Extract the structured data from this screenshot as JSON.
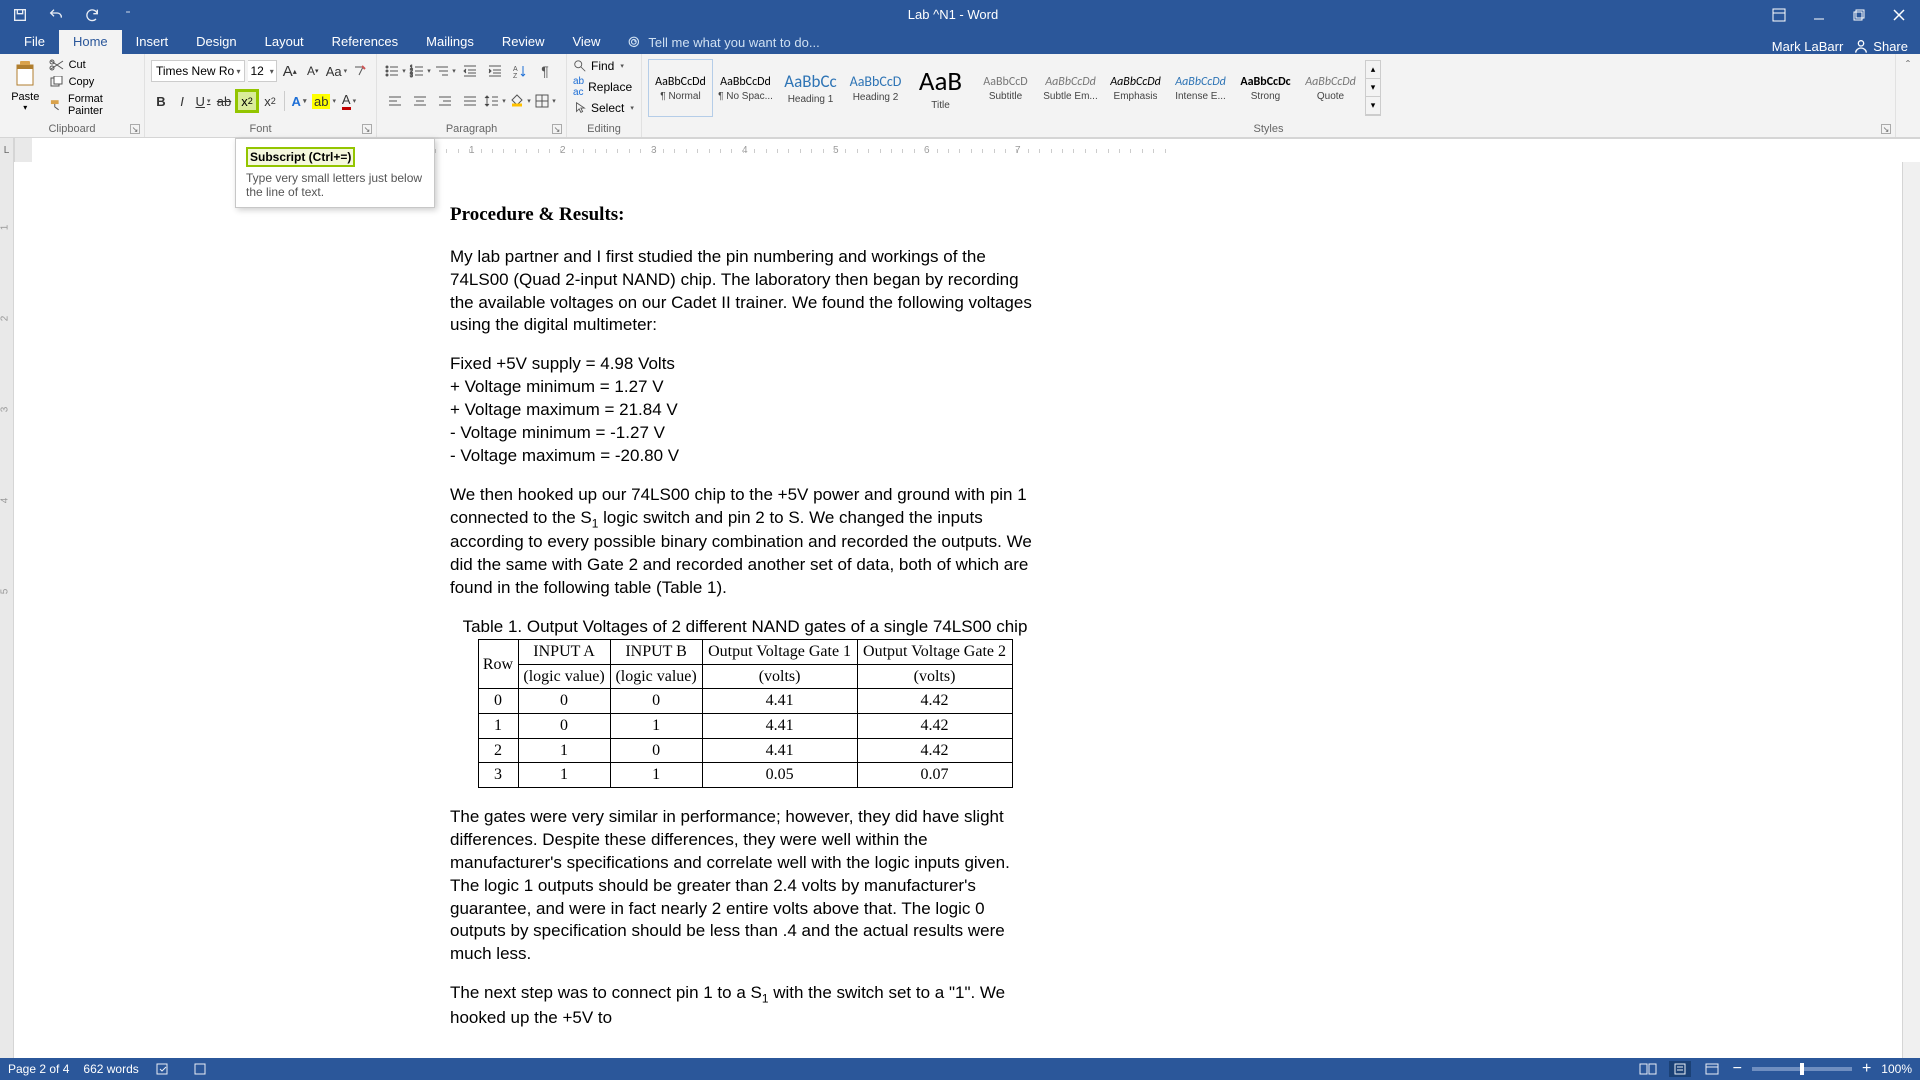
{
  "title": "Lab ^N1 - Word",
  "user": "Mark LaBarr",
  "share": "Share",
  "tabs": [
    "File",
    "Home",
    "Insert",
    "Design",
    "Layout",
    "References",
    "Mailings",
    "Review",
    "View"
  ],
  "tellme_placeholder": "Tell me what you want to do...",
  "clipboard": {
    "paste": "Paste",
    "cut": "Cut",
    "copy": "Copy",
    "painter": "Format Painter",
    "label": "Clipboard"
  },
  "font": {
    "name": "Times New Ro",
    "size": "12",
    "label": "Font"
  },
  "paragraph": {
    "label": "Paragraph"
  },
  "editing": {
    "find": "Find",
    "replace": "Replace",
    "select": "Select",
    "label": "Editing"
  },
  "styles": {
    "label": "Styles",
    "items": [
      {
        "preview": "AaBbCcDd",
        "name": "¶ Normal",
        "size": "12px",
        "color": "#000"
      },
      {
        "preview": "AaBbCcDd",
        "name": "¶ No Spac...",
        "size": "12px",
        "color": "#000"
      },
      {
        "preview": "AaBbCc",
        "name": "Heading 1",
        "size": "17px",
        "color": "#2e74b5"
      },
      {
        "preview": "AaBbCcD",
        "name": "Heading 2",
        "size": "14px",
        "color": "#2e74b5"
      },
      {
        "preview": "AaB",
        "name": "Title",
        "size": "27px",
        "color": "#000"
      },
      {
        "preview": "AaBbCcD",
        "name": "Subtitle",
        "size": "12px",
        "color": "#777"
      },
      {
        "preview": "AaBbCcDd",
        "name": "Subtle Em...",
        "size": "12px",
        "color": "#777",
        "italic": true
      },
      {
        "preview": "AaBbCcDd",
        "name": "Emphasis",
        "size": "12px",
        "color": "#000",
        "italic": true
      },
      {
        "preview": "AaBbCcDd",
        "name": "Intense E...",
        "size": "12px",
        "color": "#2e74b5",
        "italic": true
      },
      {
        "preview": "AaBbCcDc",
        "name": "Strong",
        "size": "12px",
        "color": "#000",
        "bold": true
      },
      {
        "preview": "AaBbCcDd",
        "name": "Quote",
        "size": "12px",
        "color": "#777",
        "italic": true
      }
    ]
  },
  "tooltip": {
    "title": "Subscript (Ctrl+=)",
    "desc": "Type very small letters just below the line of text."
  },
  "status": {
    "page": "Page 2 of 4",
    "words": "662 words",
    "zoom": "100%"
  },
  "ruler_corner": "L",
  "doc": {
    "heading": "Procedure & Results:",
    "p1": "My lab partner and I first studied the pin numbering and workings of the 74LS00 (Quad 2-input NAND) chip. The laboratory then began by recording the available voltages on our Cadet II trainer. We found the following voltages using the digital multimeter:",
    "v1": "Fixed +5V supply = 4.98 Volts",
    "v2": "+ Voltage minimum = 1.27 V",
    "v3": "+ Voltage maximum = 21.84 V",
    "v4": "- Voltage minimum = -1.27 V",
    "v5": "- Voltage maximum = -20.80 V",
    "p2a": "We then hooked up our 74LS00 chip to the +5V power and ground with pin 1 connected to the S",
    "p2b": " logic switch and pin 2 to S. We changed the inputs according to every possible binary combination and recorded the outputs. We did the same with Gate 2 and recorded another set of data, both of which are found in the following table (Table 1).",
    "caption": "Table 1. Output Voltages of 2 different NAND gates of a single 74LS00 chip",
    "headers": {
      "row": "Row",
      "ia1": "INPUT A",
      "ia2": "(logic value)",
      "ib1": "INPUT B",
      "ib2": "(logic value)",
      "g1a": "Output Voltage Gate 1",
      "g1b": "(volts)",
      "g2a": "Output Voltage Gate 2",
      "g2b": "(volts)"
    },
    "rows": [
      {
        "r": "0",
        "a": "0",
        "b": "0",
        "g1": "4.41",
        "g2": "4.42"
      },
      {
        "r": "1",
        "a": "0",
        "b": "1",
        "g1": "4.41",
        "g2": "4.42"
      },
      {
        "r": "2",
        "a": "1",
        "b": "0",
        "g1": "4.41",
        "g2": "4.42"
      },
      {
        "r": "3",
        "a": "1",
        "b": "1",
        "g1": "0.05",
        "g2": "0.07"
      }
    ],
    "p3": "The gates were very similar in performance; however, they did have slight differences. Despite these differences, they were well within the manufacturer's specifications and correlate well with the logic inputs given. The logic 1 outputs should be greater than 2.4 volts by manufacturer's guarantee, and were in fact nearly 2 entire volts above that. The logic 0 outputs by specification should be less than .4 and the actual results were much less.",
    "p4a": "The next step was to connect pin 1 to a S",
    "p4b": " with the switch set to a \"1\". We hooked up the +5V to"
  }
}
